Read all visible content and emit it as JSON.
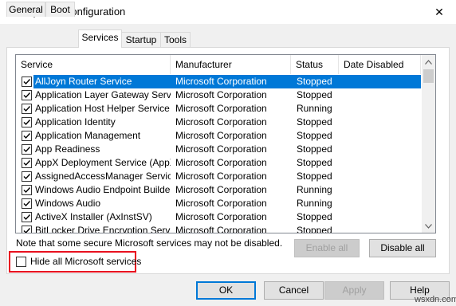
{
  "window": {
    "title": "System Configuration",
    "close_glyph": "✕"
  },
  "tabs": [
    {
      "label": "General",
      "active": false
    },
    {
      "label": "Boot",
      "active": false
    },
    {
      "label": "Services",
      "active": true
    },
    {
      "label": "Startup",
      "active": false
    },
    {
      "label": "Tools",
      "active": false
    }
  ],
  "services_table": {
    "columns": [
      "Service",
      "Manufacturer",
      "Status",
      "Date Disabled"
    ],
    "rows": [
      {
        "service": "AllJoyn Router Service",
        "manufacturer": "Microsoft Corporation",
        "status": "Stopped",
        "date_disabled": "",
        "checked": true,
        "selected": true
      },
      {
        "service": "Application Layer Gateway Service",
        "manufacturer": "Microsoft Corporation",
        "status": "Stopped",
        "date_disabled": "",
        "checked": true,
        "selected": false
      },
      {
        "service": "Application Host Helper Service",
        "manufacturer": "Microsoft Corporation",
        "status": "Running",
        "date_disabled": "",
        "checked": true,
        "selected": false
      },
      {
        "service": "Application Identity",
        "manufacturer": "Microsoft Corporation",
        "status": "Stopped",
        "date_disabled": "",
        "checked": true,
        "selected": false
      },
      {
        "service": "Application Management",
        "manufacturer": "Microsoft Corporation",
        "status": "Stopped",
        "date_disabled": "",
        "checked": true,
        "selected": false
      },
      {
        "service": "App Readiness",
        "manufacturer": "Microsoft Corporation",
        "status": "Stopped",
        "date_disabled": "",
        "checked": true,
        "selected": false
      },
      {
        "service": "AppX Deployment Service (AppX...",
        "manufacturer": "Microsoft Corporation",
        "status": "Stopped",
        "date_disabled": "",
        "checked": true,
        "selected": false
      },
      {
        "service": "AssignedAccessManager Service",
        "manufacturer": "Microsoft Corporation",
        "status": "Stopped",
        "date_disabled": "",
        "checked": true,
        "selected": false
      },
      {
        "service": "Windows Audio Endpoint Builder",
        "manufacturer": "Microsoft Corporation",
        "status": "Running",
        "date_disabled": "",
        "checked": true,
        "selected": false
      },
      {
        "service": "Windows Audio",
        "manufacturer": "Microsoft Corporation",
        "status": "Running",
        "date_disabled": "",
        "checked": true,
        "selected": false
      },
      {
        "service": "ActiveX Installer (AxInstSV)",
        "manufacturer": "Microsoft Corporation",
        "status": "Stopped",
        "date_disabled": "",
        "checked": true,
        "selected": false
      },
      {
        "service": "BitLocker Drive Encryption Service",
        "manufacturer": "Microsoft Corporation",
        "status": "Stopped",
        "date_disabled": "",
        "checked": true,
        "selected": false
      }
    ]
  },
  "note": "Note that some secure Microsoft services may not be disabled.",
  "buttons": {
    "enable_all": "Enable all",
    "disable_all": "Disable all",
    "ok": "OK",
    "cancel": "Cancel",
    "apply": "Apply",
    "help": "Help"
  },
  "hide_ms_services": {
    "label": "Hide all Microsoft services",
    "checked": false
  },
  "watermark": "wsxdn.com",
  "colors": {
    "selection": "#0078d7",
    "highlight_box": "#e8101f"
  }
}
